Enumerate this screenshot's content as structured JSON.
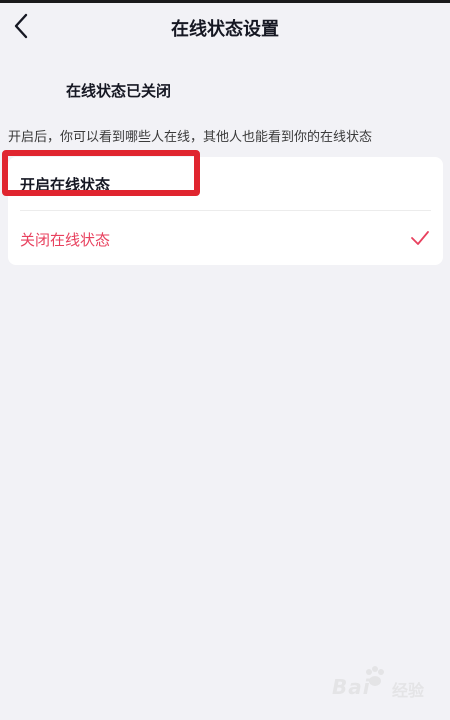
{
  "header": {
    "title": "在线状态设置",
    "back_icon": "chevron-left-icon"
  },
  "status": {
    "heading": "在线状态已关闭",
    "description": "开启后，你可以看到哪些人在线，其他人也能看到你的在线状态"
  },
  "options": [
    {
      "label": "开启在线状态",
      "selected": false
    },
    {
      "label": "关闭在线状态",
      "selected": true
    }
  ],
  "colors": {
    "accent": "#e8415e",
    "highlight_box": "#e0252f",
    "background": "#f2f2f6"
  },
  "watermark": {
    "brand": "Bai",
    "suffix": "经验"
  }
}
